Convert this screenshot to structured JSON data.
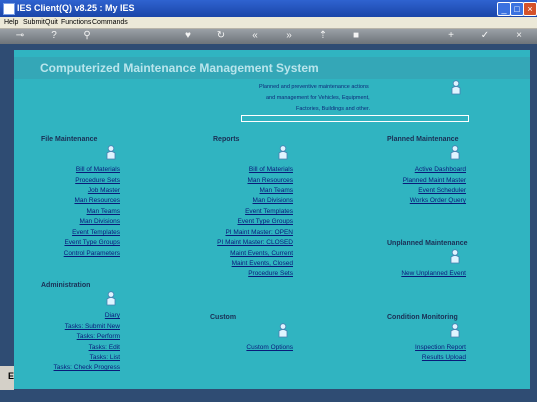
{
  "window": {
    "title": "IES Client(Q) v8.25 : My IES"
  },
  "menu": [
    "Help",
    "Submit",
    "Quit",
    "Functions",
    "Commands"
  ],
  "toolbar_icons": [
    "key-icon",
    "help-icon",
    "search-icon",
    "heart-icon",
    "refresh-icon",
    "rewind-icon",
    "forward-icon",
    "export-icon",
    "stop-icon",
    "add-icon",
    "check-icon",
    "close-icon"
  ],
  "header": {
    "title": "Computerized Maintenance Management System",
    "description": [
      "Planned and preventive maintenance actions",
      "and management for Vehicles, Equipment,",
      "Factories, Buildings and other."
    ]
  },
  "sections": {
    "file_maintenance": {
      "heading": "File Maintenance",
      "links": [
        "Bill of Materials",
        "Procedure Sets",
        "Job Master",
        "Man Resources",
        "Man Teams",
        "Man Divisions",
        "Event Templates",
        "Event Type Groups",
        "Control Parameters"
      ]
    },
    "reports": {
      "heading": "Reports",
      "links": [
        "Bill of Materials",
        "Man Resources",
        "Man Teams",
        "Man Divisions",
        "Event Templates",
        "Event Type Groups",
        "PI Maint Master: OPEN",
        "PI Maint Master: CLOSED",
        "Maint Events, Current",
        "Maint Events, Closed",
        "Procedure Sets"
      ]
    },
    "planned": {
      "heading": "Planned Maintenance",
      "links": [
        "Active Dashboard",
        "Planned Maint Master",
        "Event Scheduler",
        "Works Order Query"
      ]
    },
    "unplanned": {
      "heading": "Unplanned Maintenance",
      "links": [
        "New Unplanned Event"
      ]
    },
    "administration": {
      "heading": "Administration",
      "links": [
        "Diary",
        "Tasks: Submit New",
        "Tasks: Perform",
        "Tasks: Edit",
        "Tasks: List",
        "Tasks: Check Progress"
      ]
    },
    "custom": {
      "heading": "Custom",
      "links": [
        "Custom Options"
      ]
    },
    "condition": {
      "heading": "Condition Monitoring",
      "links": [
        "Inspection Report",
        "Results Upload"
      ]
    }
  },
  "left_mark": "E"
}
